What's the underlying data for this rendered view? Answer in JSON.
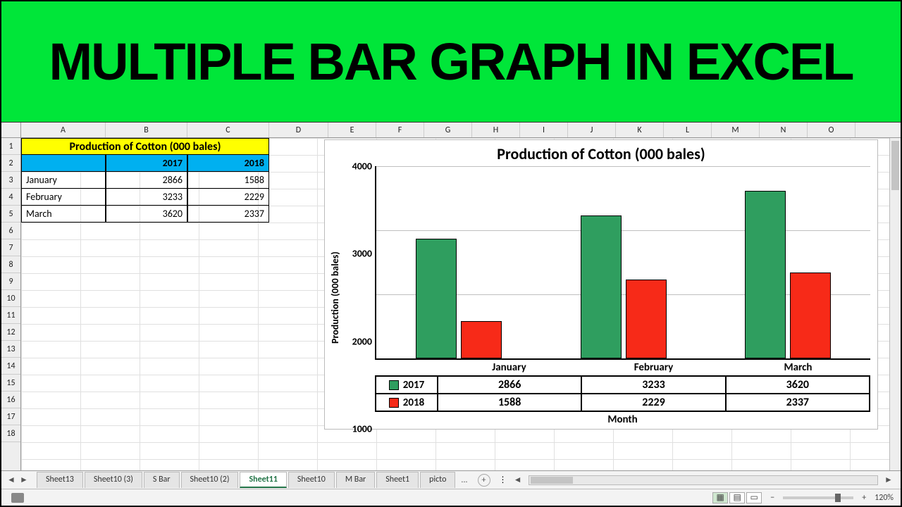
{
  "banner": {
    "title": "MULTIPLE BAR GRAPH IN EXCEL"
  },
  "columns": [
    "A",
    "B",
    "C",
    "D",
    "E",
    "F",
    "G",
    "H",
    "I",
    "J",
    "K",
    "L",
    "M",
    "N",
    "O"
  ],
  "rows": [
    "1",
    "2",
    "3",
    "4",
    "5",
    "6",
    "7",
    "8",
    "9",
    "10",
    "11",
    "12",
    "13",
    "14",
    "15",
    "16",
    "17",
    "18"
  ],
  "table": {
    "title": "Production of Cotton (000 bales)",
    "headers": {
      "c1": "",
      "c2": "2017",
      "c3": "2018"
    },
    "rows": [
      {
        "m": "January",
        "y17": "2866",
        "y18": "1588"
      },
      {
        "m": "February",
        "y17": "3233",
        "y18": "2229"
      },
      {
        "m": "March",
        "y17": "3620",
        "y18": "2337"
      }
    ]
  },
  "chart_data": {
    "type": "bar",
    "title": "Production of Cotton (000 bales)",
    "xlabel": "Month",
    "ylabel": "Production (000 bales)",
    "ylim": [
      1000,
      4000
    ],
    "yticks": [
      1000,
      2000,
      3000,
      4000
    ],
    "categories": [
      "January",
      "February",
      "March"
    ],
    "series": [
      {
        "name": "2017",
        "values": [
          2866,
          3233,
          3620
        ],
        "color": "#2f9e5f"
      },
      {
        "name": "2018",
        "values": [
          1588,
          2229,
          2337
        ],
        "color": "#f72a18"
      }
    ]
  },
  "tabs": {
    "items": [
      "Sheet13",
      "Sheet10 (3)",
      "S Bar",
      "Sheet10 (2)",
      "Sheet11",
      "Sheet10",
      "M Bar",
      "Sheet1",
      "picto"
    ],
    "active": "Sheet11",
    "more": "..."
  },
  "status": {
    "zoom": "120%"
  }
}
